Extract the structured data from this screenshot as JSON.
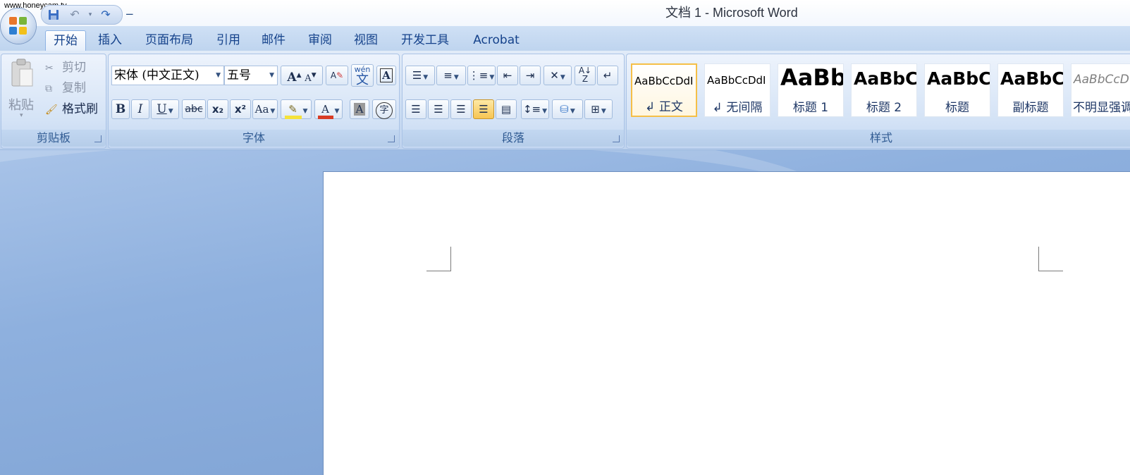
{
  "watermark": "www.honeycam.tv",
  "window_title": "文档 1 - Microsoft Word",
  "tabs": [
    {
      "label": "开始",
      "active": true
    },
    {
      "label": "插入"
    },
    {
      "label": "页面布局"
    },
    {
      "label": "引用"
    },
    {
      "label": "邮件"
    },
    {
      "label": "审阅"
    },
    {
      "label": "视图"
    },
    {
      "label": "开发工具"
    },
    {
      "label": "Acrobat"
    }
  ],
  "clipboard": {
    "paste": "粘贴",
    "cut": "剪切",
    "copy": "复制",
    "format_painter": "格式刷",
    "label": "剪贴板"
  },
  "font": {
    "name": "宋体 (中文正文)",
    "size": "五号",
    "label": "字体",
    "bold": "B",
    "italic": "I",
    "underline": "U",
    "strike": "abc",
    "subscript": "x₂",
    "superscript": "x²",
    "change_case": "Aa",
    "grow": "A",
    "shrink": "A",
    "phonetic": "wén",
    "phonetic_char": "文",
    "border_char": "A",
    "enclose_char": "字",
    "font_color": "A",
    "shading_char": "A"
  },
  "paragraph": {
    "label": "段落"
  },
  "styles": {
    "label": "样式",
    "items": [
      {
        "sample": "AaBbCcDdI",
        "name": "↲ 正文",
        "selected": true
      },
      {
        "sample": "AaBbCcDdI",
        "name": "↲ 无间隔"
      },
      {
        "sample": "AaBb",
        "name": "标题 1"
      },
      {
        "sample": "AaBbC",
        "name": "标题 2"
      },
      {
        "sample": "AaBbC",
        "name": "标题"
      },
      {
        "sample": "AaBbC",
        "name": "副标题"
      },
      {
        "sample": "AaBbCcD",
        "name": "不明显强调"
      }
    ]
  },
  "colors": {
    "ribbon_text": "#15428b",
    "highlight_yellow": "#f5e23a",
    "font_red": "#d83b24",
    "selected_style_border": "#f5bf47"
  }
}
